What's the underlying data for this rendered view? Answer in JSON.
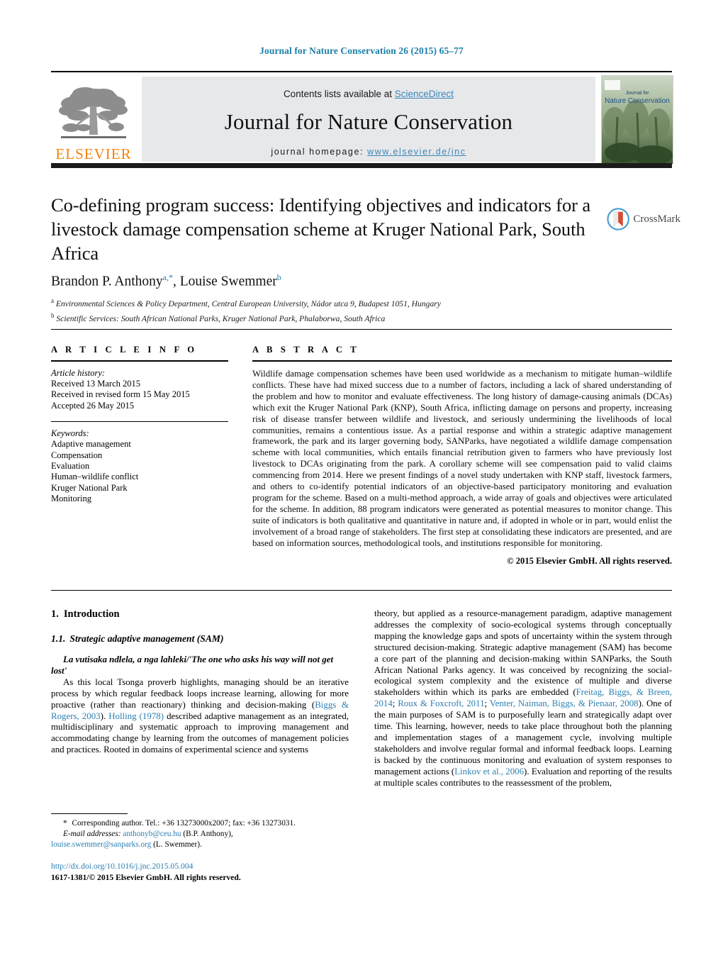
{
  "running_head": "Journal for Nature Conservation 26 (2015) 65–77",
  "masthead": {
    "contents_prefix": "Contents lists available at ",
    "sciencedirect": "ScienceDirect",
    "journal_name": "Journal for Nature Conservation",
    "homepage_prefix": "journal homepage:",
    "homepage_url": "www.elsevier.de/jnc",
    "publisher_logo_text": "ELSEVIER",
    "publisher_logo_icon": "elsevier-tree-icon",
    "cover_thumb_icon": "journal-cover-thumbnail",
    "cover_title_line1": "Journal for",
    "cover_title_line2": "Nature Conservation",
    "colors": {
      "link": "#3c87b8",
      "elsevier_orange": "#f5820b",
      "running_head": "#1a7fa8",
      "panel_gray": "#e7e8ea"
    }
  },
  "article": {
    "title": "Co-defining program success: Identifying objectives and indicators for a livestock damage compensation scheme at Kruger National Park, South Africa",
    "crossmark_label": "CrossMark",
    "authors_html": "Brandon P. Anthony<sup class=\"aff-mark\">a,</sup><sup class=\"aff-mark\">*</sup>, Louise Swemmer<sup class=\"aff-mark\">b</sup>",
    "authors_plain": "Brandon P. Anthony a,*, Louise Swemmer b",
    "affiliations": [
      {
        "mark": "a",
        "text": "Environmental Sciences & Policy Department, Central European University, Nádor utca 9, Budapest 1051, Hungary"
      },
      {
        "mark": "b",
        "text": "Scientific Services: South African National Parks, Kruger National Park, Phalaborwa, South Africa"
      }
    ]
  },
  "article_info": {
    "heading": "A R T I C L E    I N F O",
    "history_label": "Article history:",
    "history": [
      "Received 13 March 2015",
      "Received in revised form 15 May 2015",
      "Accepted 26 May 2015"
    ],
    "keywords_label": "Keywords:",
    "keywords": [
      "Adaptive management",
      "Compensation",
      "Evaluation",
      "Human–wildlife conflict",
      "Kruger National Park",
      "Monitoring"
    ]
  },
  "abstract": {
    "heading": "A B S T R A C T",
    "text": "Wildlife damage compensation schemes have been used worldwide as a mechanism to mitigate human–wildlife conflicts. These have had mixed success due to a number of factors, including a lack of shared understanding of the problem and how to monitor and evaluate effectiveness. The long history of damage-causing animals (DCAs) which exit the Kruger National Park (KNP), South Africa, inflicting damage on persons and property, increasing risk of disease transfer between wildlife and livestock, and seriously undermining the livelihoods of local communities, remains a contentious issue. As a partial response and within a strategic adaptive management framework, the park and its larger governing body, SANParks, have negotiated a wildlife damage compensation scheme with local communities, which entails financial retribution given to farmers who have previously lost livestock to DCAs originating from the park. A corollary scheme will see compensation paid to valid claims commencing from 2014. Here we present findings of a novel study undertaken with KNP staff, livestock farmers, and others to co-identify potential indicators of an objective-based participatory monitoring and evaluation program for the scheme. Based on a multi-method approach, a wide array of goals and objectives were articulated for the scheme. In addition, 88 program indicators were generated as potential measures to monitor change. This suite of indicators is both qualitative and quantitative in nature and, if adopted in whole or in part, would enlist the involvement of a broad range of stakeholders. The first step at consolidating these indicators are presented, and are based on information sources, methodological tools, and institutions responsible for monitoring.",
    "copyright": "© 2015 Elsevier GmbH. All rights reserved."
  },
  "body": {
    "section1_num": "1.",
    "section1_title": "Introduction",
    "section11_num": "1.1.",
    "section11_title": "Strategic adaptive management (SAM)",
    "proverb": "La vutisaka ndlela, a nga lahleki/'The one who asks his way will not get lost'",
    "left_para_html": "As this local Tsonga proverb highlights, managing should be an iterative process by which regular feedback loops increase learning, allowing for more proactive (rather than reactionary) thinking and decision-making (<span class=\"cite\">Biggs &amp; Rogers, 2003</span>). <span class=\"cite\">Holling (1978)</span> described adaptive management as an integrated, multidisciplinary and systematic approach to improving management and accommodating change by learning from the outcomes of management policies and practices. Rooted in domains of experimental science and systems",
    "right_para_html": "theory, but applied as a resource-management paradigm, adaptive management addresses the complexity of socio-ecological systems through conceptually mapping the knowledge gaps and spots of uncertainty within the system through structured decision-making. Strategic adaptive management (SAM) has become a core part of the planning and decision-making within SANParks, the South African National Parks agency. It was conceived by recognizing the social-ecological system complexity and the existence of multiple and diverse stakeholders within which its parks are embedded (<span class=\"cite\">Freitag, Biggs, &amp; Breen, 2014</span>; <span class=\"cite\">Roux &amp; Foxcroft, 2011</span>; <span class=\"cite\">Venter, Naiman, Biggs, &amp; Pienaar, 2008</span>). One of the main purposes of SAM is to purposefully learn and strategically adapt over time. This learning, however, needs to take place throughout both the planning and implementation stages of a management cycle, involving multiple stakeholders and involve regular formal and informal feedback loops. Learning is backed by the continuous monitoring and evaluation of system responses to management actions (<span class=\"cite\">Linkov et al., 2006</span>). Evaluation and reporting of the results at multiple scales contributes to the reassessment of the problem,"
  },
  "footnotes": {
    "corresponding_html": "<span class=\"star\">*</span> Corresponding author. Tel.: +36 13273000x2007; fax: +36 13273031.",
    "email_label": "E-mail addresses:",
    "email1": "anthonyb@ceu.hu",
    "email1_owner": "(B.P. Anthony),",
    "email2": "louise.swemmer@sanparks.org",
    "email2_owner": "(L. Swemmer).",
    "doi": "http://dx.doi.org/10.1016/j.jnc.2015.05.004",
    "issn_line": "1617-1381/© 2015 Elsevier GmbH. All rights reserved."
  }
}
